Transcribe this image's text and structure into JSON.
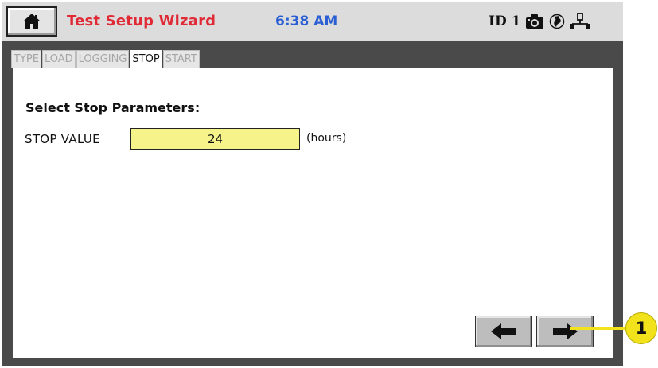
{
  "app": {
    "title": "Test Setup Wizard",
    "time": "6:38 AM"
  },
  "header": {
    "home_icon": "home-icon",
    "status": {
      "id_label": "ID 1",
      "icons": [
        "camera-icon",
        "globe-icon",
        "network-icon"
      ]
    }
  },
  "tabs": [
    {
      "label": "TYPE",
      "active": false
    },
    {
      "label": "LOAD",
      "active": false
    },
    {
      "label": "LOGGING",
      "active": false
    },
    {
      "label": "STOP",
      "active": true
    },
    {
      "label": "START",
      "active": false
    }
  ],
  "stop": {
    "section_title": "Select Stop Parameters:",
    "field_label": "STOP VALUE",
    "value": "24",
    "unit": "(hours)"
  },
  "navigation": {
    "back_icon": "arrow-left-icon",
    "next_icon": "arrow-right-icon"
  },
  "annotation": {
    "callout_number": "1"
  },
  "colors": {
    "title": "#e02a35",
    "clock": "#2a5fd4",
    "input_fill": "#f5f38a",
    "callout": "#f2e21c",
    "frame": "#4a4a4a"
  }
}
